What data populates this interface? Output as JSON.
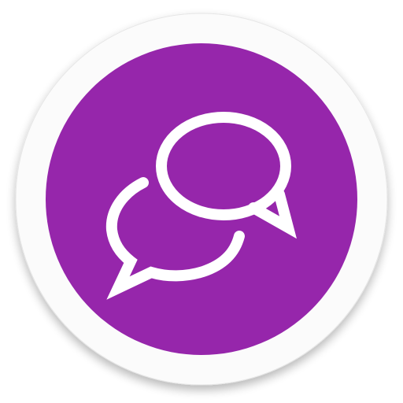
{
  "icon": {
    "name": "chat-bubbles-icon",
    "colors": {
      "ring": "#fbfbfb",
      "ring_edge": "#e6e6e6",
      "disc": "#9626ab",
      "glyph": "#ffffff"
    }
  }
}
